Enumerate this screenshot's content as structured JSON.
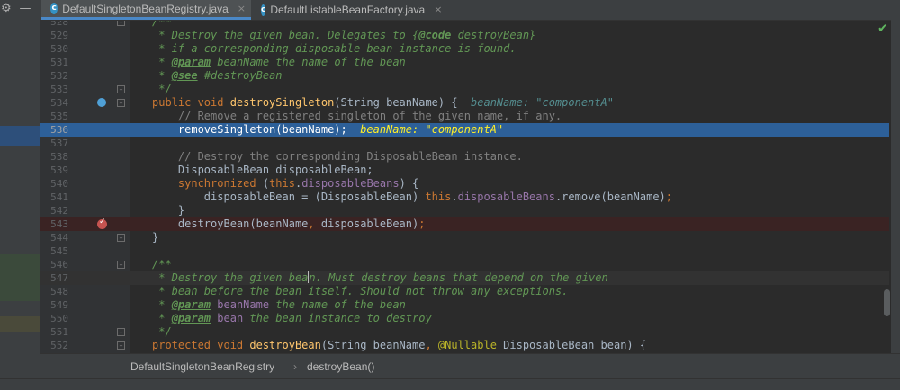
{
  "toolbar": {
    "settings_icon": "gear-icon",
    "collapse_icon": "minus-icon"
  },
  "tabs": [
    {
      "label": "DefaultSingletonBeanRegistry.java",
      "active": true
    },
    {
      "label": "DefaultListableBeanFactory.java",
      "active": false
    }
  ],
  "tab_close_glyph": "×",
  "editor": {
    "first_line_number": 528,
    "lines": [
      {
        "n": "528",
        "html": "<span class='cm'>/**</span>"
      },
      {
        "n": "529",
        "html": "<span class='cm'> * Destroy the given bean. Delegates to {</span><span class='tag'>@code</span><span class='cm'> destroyBean}</span>"
      },
      {
        "n": "530",
        "html": "<span class='cm'> * if a corresponding disposable bean instance is found.</span>"
      },
      {
        "n": "531",
        "html": "<span class='cm'> * </span><span class='tag'>@param</span><span class='cm'> beanName the name of the bean</span>"
      },
      {
        "n": "532",
        "html": "<span class='cm'> * </span><span class='tag'>@see</span><span class='cm'> #destroyBean</span>"
      },
      {
        "n": "533",
        "html": "<span class='cm'> */</span>"
      },
      {
        "n": "534",
        "html": "<span class='kw'>public void </span><span class='fn'>destroySingleton</span>(String beanName) {  <span class='inl'>beanName: \"componentA\"</span>"
      },
      {
        "n": "535",
        "html": "    <span class='cmt'>// Remove a registered singleton of the given name, if any.</span>"
      },
      {
        "n": "536",
        "html": "    removeSingleton(beanName);  <span class='inl'>beanName: \"componentA\"</span>"
      },
      {
        "n": "537",
        "html": ""
      },
      {
        "n": "538",
        "html": "    <span class='cmt'>// Destroy the corresponding DisposableBean instance.</span>"
      },
      {
        "n": "539",
        "html": "    DisposableBean disposableBean;"
      },
      {
        "n": "540",
        "html": "    <span class='kw'>synchronized </span>(<span class='kw'>this</span>.<span class='fld'>disposableBeans</span>) {"
      },
      {
        "n": "541",
        "html": "        disposableBean = (DisposableBean) <span class='kw'>this</span>.<span class='fld'>disposableBeans</span>.remove(beanName)<span class='kw'>;</span>"
      },
      {
        "n": "542",
        "html": "    }"
      },
      {
        "n": "543",
        "html": "    destroyBean(beanName<span class='kw'>, </span>disposableBean)<span class='kw'>;</span>"
      },
      {
        "n": "544",
        "html": "}"
      },
      {
        "n": "545",
        "html": ""
      },
      {
        "n": "546",
        "html": "<span class='cm'>/**</span>"
      },
      {
        "n": "547",
        "html": "<span class='cm'> * Destroy the given bea</span><span class='caret'></span><span class='cm'>n. Must destroy beans that depend on the given</span>"
      },
      {
        "n": "548",
        "html": "<span class='cm'> * bean before the bean itself. Should not throw any exceptions.</span>"
      },
      {
        "n": "549",
        "html": "<span class='cm'> * </span><span class='tag'>@param</span><span class='cm'> </span><span class='fld'>beanName</span><span class='cm'> the name of the bean</span>"
      },
      {
        "n": "550",
        "html": "<span class='cm'> * </span><span class='tag'>@param</span><span class='cm'> </span><span class='fld'>bean</span><span class='cm'> the bean instance to destroy</span>"
      },
      {
        "n": "551",
        "html": "<span class='cm'> */</span>"
      },
      {
        "n": "552",
        "html": "<span class='kw'>protected void </span><span class='fn'>destroyBean</span>(String beanName<span class='kw'>, </span><span class='ann'>@Nullable </span>DisposableBean bean) {"
      }
    ]
  },
  "breadcrumb": {
    "items": [
      "DefaultSingletonBeanRegistry",
      "destroyBean()"
    ],
    "separator": "›"
  },
  "colors": {
    "exec_line": "#2d6099",
    "breakpoint": "#c75450",
    "accent": "#4a88c7"
  }
}
